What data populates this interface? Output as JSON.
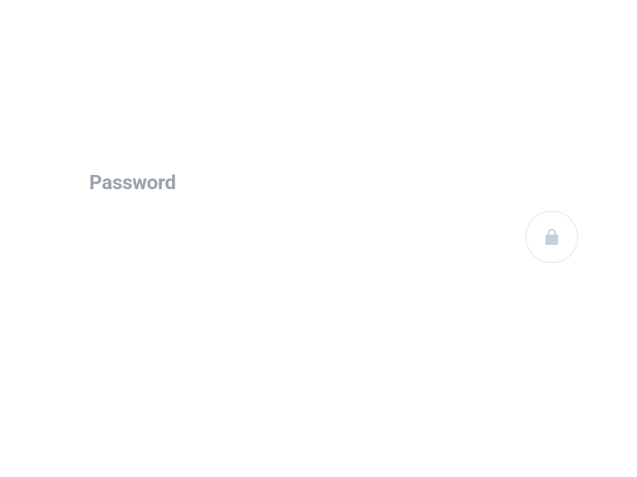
{
  "field": {
    "label": "Password",
    "value": "",
    "placeholder": ""
  },
  "icons": {
    "lock_name": "lock-icon"
  },
  "colors": {
    "label": "#9aa3ab",
    "border": "#dfe6ea",
    "icon": "#c6d0d6",
    "text": "#222222"
  }
}
